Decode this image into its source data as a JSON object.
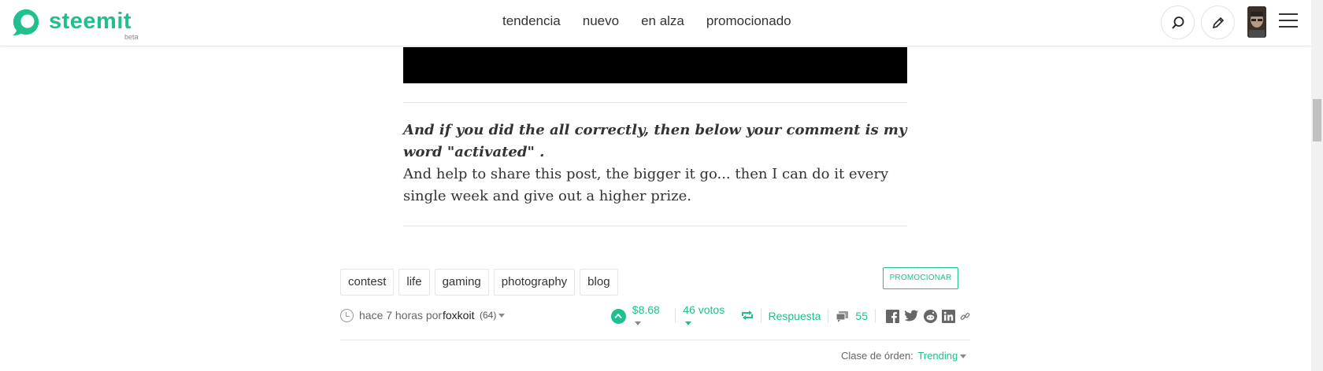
{
  "header": {
    "logo_text": "steemit",
    "logo_sub": "beta",
    "nav": [
      "tendencia",
      "nuevo",
      "en alza",
      "promocionado"
    ]
  },
  "post": {
    "paragraph_bold": "And if you did the all correctly, then below your comment is my word \"activated\" .",
    "paragraph_text": "And help to share this post, the bigger it go... then I can do it every single week and give out a higher prize."
  },
  "tags": [
    "contest",
    "life",
    "gaming",
    "photography",
    "blog"
  ],
  "promote_label": "PROMOCIONAR",
  "meta": {
    "time": "hace 7 horas por",
    "author": "foxkoit",
    "reputation": "(64)",
    "payout": "$8.68",
    "votes": "46 votos",
    "reply": "Respuesta",
    "comments": "55"
  },
  "sort": {
    "label": "Clase de órden:",
    "value": "Trending"
  },
  "colors": {
    "brand": "#1fbf8f"
  }
}
